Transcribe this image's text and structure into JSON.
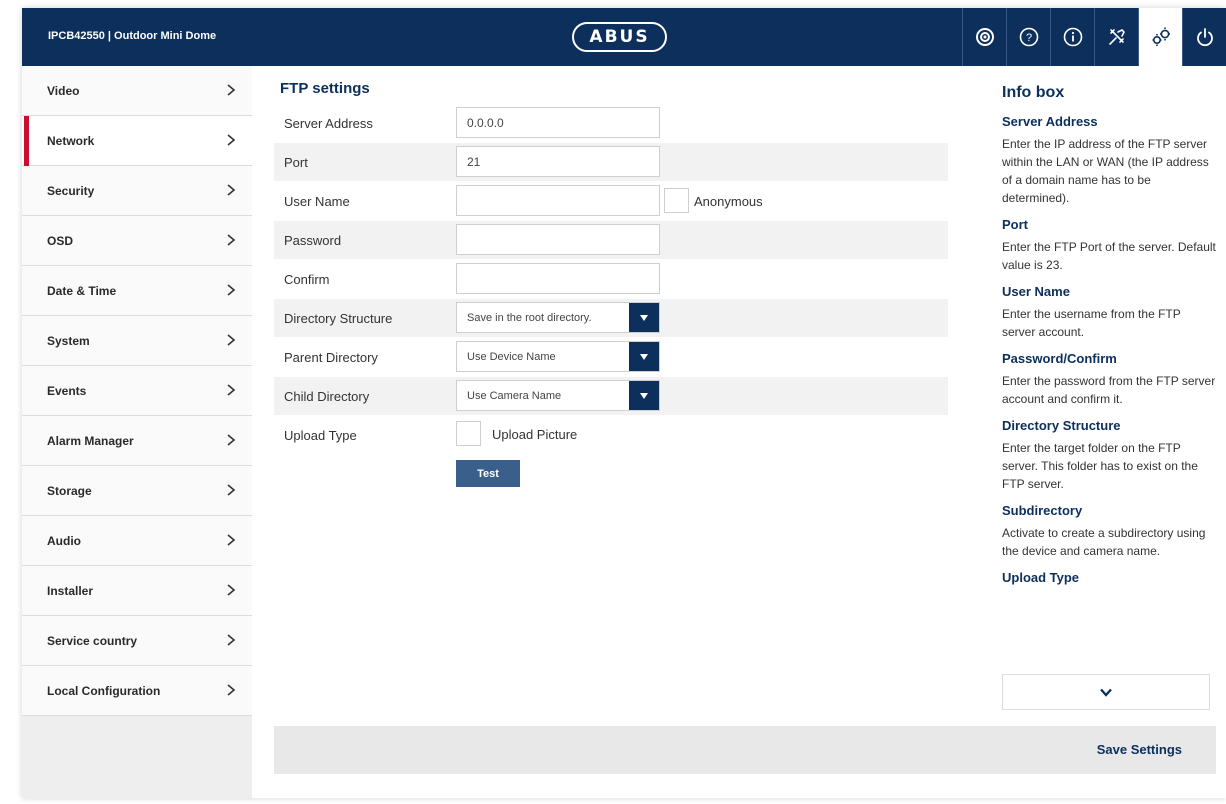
{
  "header": {
    "device_title": "IPCB42550 | Outdoor Mini Dome",
    "logo": "ABUS",
    "icons": [
      "camera-icon",
      "help-icon",
      "info-icon",
      "tools-icon",
      "settings-icon",
      "power-icon"
    ],
    "active_icon": "settings-icon"
  },
  "sidebar": {
    "items": [
      {
        "label": "Video"
      },
      {
        "label": "Network"
      },
      {
        "label": "Security"
      },
      {
        "label": "OSD"
      },
      {
        "label": "Date & Time"
      },
      {
        "label": "System"
      },
      {
        "label": "Events"
      },
      {
        "label": "Alarm Manager"
      },
      {
        "label": "Storage"
      },
      {
        "label": "Audio"
      },
      {
        "label": "Installer"
      },
      {
        "label": "Service country"
      },
      {
        "label": "Local Configuration"
      }
    ],
    "active_label": "Network",
    "chevron": ">"
  },
  "form": {
    "title": "FTP settings",
    "server_address": {
      "label": "Server Address",
      "value": "0.0.0.0"
    },
    "port": {
      "label": "Port",
      "value": "21"
    },
    "user_name": {
      "label": "User Name",
      "value": "",
      "anonymous_label": "Anonymous"
    },
    "password": {
      "label": "Password",
      "value": ""
    },
    "confirm": {
      "label": "Confirm",
      "value": ""
    },
    "directory_structure": {
      "label": "Directory Structure",
      "value": "Save in the root directory."
    },
    "parent_directory": {
      "label": "Parent Directory",
      "value": "Use Device Name"
    },
    "child_directory": {
      "label": "Child Directory",
      "value": "Use Camera Name"
    },
    "upload_type": {
      "label": "Upload Type",
      "option_label": "Upload Picture"
    },
    "test_label": "Test"
  },
  "info_box": {
    "title": "Info box",
    "sections": [
      {
        "heading": "Server Address",
        "text": "Enter the IP address of the FTP server within the LAN or WAN (the IP address of a domain name has to be determined)."
      },
      {
        "heading": "Port",
        "text": "Enter the FTP Port of the server. Default value is 23."
      },
      {
        "heading": "User Name",
        "text": "Enter the username from the FTP server account."
      },
      {
        "heading": "Password/Confirm",
        "text": "Enter the password from the FTP server account and confirm it."
      },
      {
        "heading": "Directory Structure",
        "text": "Enter the target folder on the FTP server. This folder has to exist on the FTP server."
      },
      {
        "heading": "Subdirectory",
        "text": "Activate to create a subdirectory using the device and camera name."
      },
      {
        "heading": "Upload Type",
        "text": ""
      }
    ]
  },
  "footer": {
    "save_label": "Save Settings"
  },
  "colors": {
    "brand": "#0c2f5c",
    "accent": "#c8102e",
    "button": "#3a5f8a"
  }
}
